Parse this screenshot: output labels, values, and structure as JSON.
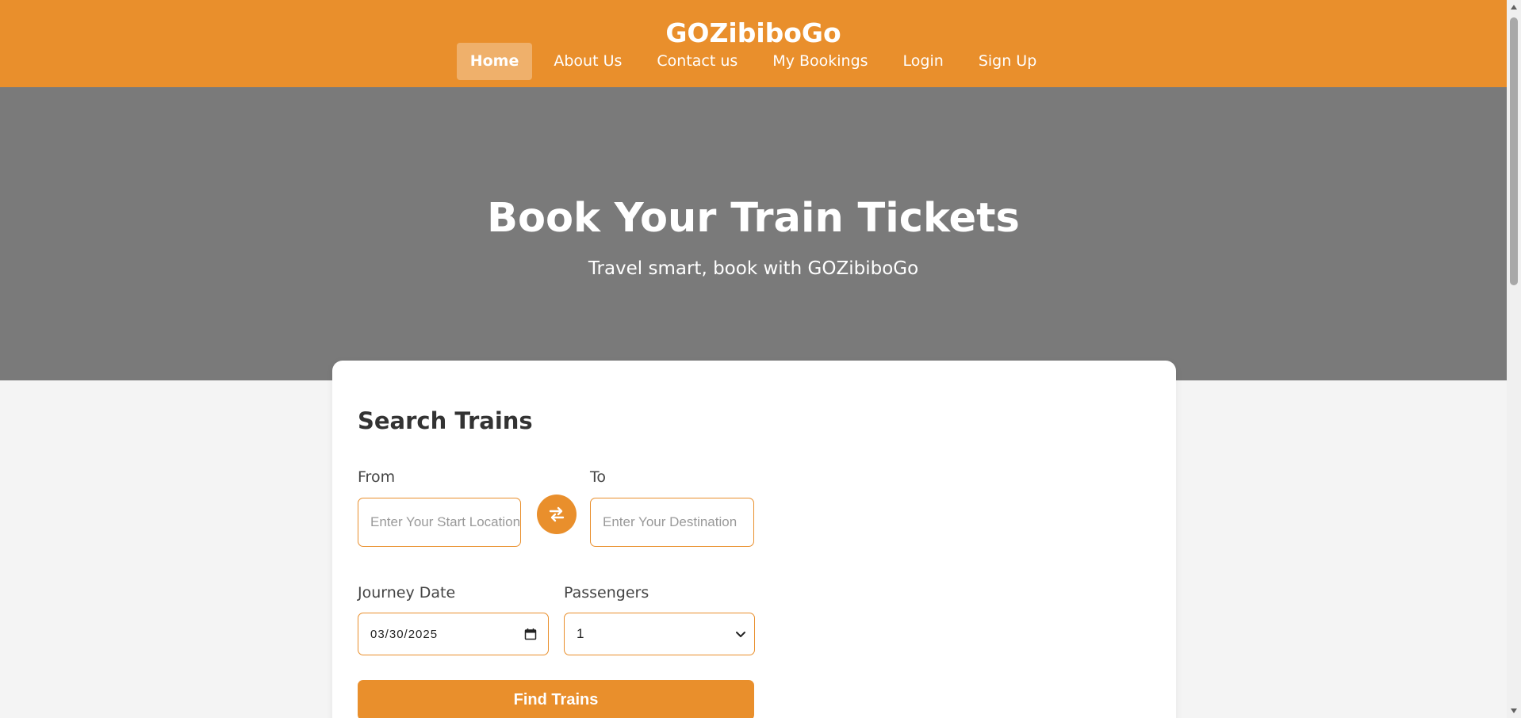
{
  "header": {
    "brand": "GOZibiboGo",
    "nav": [
      {
        "label": "Home",
        "active": true
      },
      {
        "label": "About Us",
        "active": false
      },
      {
        "label": "Contact us",
        "active": false
      },
      {
        "label": "My Bookings",
        "active": false
      },
      {
        "label": "Login",
        "active": false
      },
      {
        "label": "Sign Up",
        "active": false
      }
    ]
  },
  "hero": {
    "title": "Book Your Train Tickets",
    "subtitle": "Travel smart, book with GOZibiboGo"
  },
  "search": {
    "title": "Search Trains",
    "from_label": "From",
    "from_placeholder": "Enter Your Start Location",
    "to_label": "To",
    "to_placeholder": "Enter Your Destination",
    "swap_icon": "swap-arrows-icon",
    "date_label": "Journey Date",
    "date_value": "03/30/2025",
    "date_icon": "calendar-icon",
    "passengers_label": "Passengers",
    "passengers_value": "1",
    "find_label": "Find Trains"
  },
  "colors": {
    "accent": "#e98f2c",
    "hero_bg": "#7a7a7a",
    "page_bg": "#f4f4f4"
  }
}
